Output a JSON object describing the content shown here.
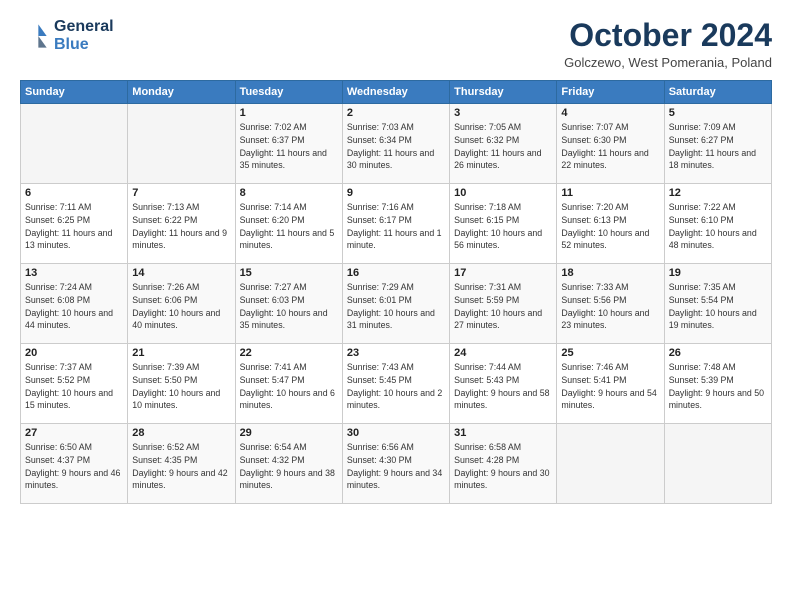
{
  "logo": {
    "line1": "General",
    "line2": "Blue"
  },
  "header": {
    "title": "October 2024",
    "subtitle": "Golczewo, West Pomerania, Poland"
  },
  "weekdays": [
    "Sunday",
    "Monday",
    "Tuesday",
    "Wednesday",
    "Thursday",
    "Friday",
    "Saturday"
  ],
  "weeks": [
    [
      {
        "day": null
      },
      {
        "day": null
      },
      {
        "day": 1,
        "sunrise": "Sunrise: 7:02 AM",
        "sunset": "Sunset: 6:37 PM",
        "daylight": "Daylight: 11 hours and 35 minutes."
      },
      {
        "day": 2,
        "sunrise": "Sunrise: 7:03 AM",
        "sunset": "Sunset: 6:34 PM",
        "daylight": "Daylight: 11 hours and 30 minutes."
      },
      {
        "day": 3,
        "sunrise": "Sunrise: 7:05 AM",
        "sunset": "Sunset: 6:32 PM",
        "daylight": "Daylight: 11 hours and 26 minutes."
      },
      {
        "day": 4,
        "sunrise": "Sunrise: 7:07 AM",
        "sunset": "Sunset: 6:30 PM",
        "daylight": "Daylight: 11 hours and 22 minutes."
      },
      {
        "day": 5,
        "sunrise": "Sunrise: 7:09 AM",
        "sunset": "Sunset: 6:27 PM",
        "daylight": "Daylight: 11 hours and 18 minutes."
      }
    ],
    [
      {
        "day": 6,
        "sunrise": "Sunrise: 7:11 AM",
        "sunset": "Sunset: 6:25 PM",
        "daylight": "Daylight: 11 hours and 13 minutes."
      },
      {
        "day": 7,
        "sunrise": "Sunrise: 7:13 AM",
        "sunset": "Sunset: 6:22 PM",
        "daylight": "Daylight: 11 hours and 9 minutes."
      },
      {
        "day": 8,
        "sunrise": "Sunrise: 7:14 AM",
        "sunset": "Sunset: 6:20 PM",
        "daylight": "Daylight: 11 hours and 5 minutes."
      },
      {
        "day": 9,
        "sunrise": "Sunrise: 7:16 AM",
        "sunset": "Sunset: 6:17 PM",
        "daylight": "Daylight: 11 hours and 1 minute."
      },
      {
        "day": 10,
        "sunrise": "Sunrise: 7:18 AM",
        "sunset": "Sunset: 6:15 PM",
        "daylight": "Daylight: 10 hours and 56 minutes."
      },
      {
        "day": 11,
        "sunrise": "Sunrise: 7:20 AM",
        "sunset": "Sunset: 6:13 PM",
        "daylight": "Daylight: 10 hours and 52 minutes."
      },
      {
        "day": 12,
        "sunrise": "Sunrise: 7:22 AM",
        "sunset": "Sunset: 6:10 PM",
        "daylight": "Daylight: 10 hours and 48 minutes."
      }
    ],
    [
      {
        "day": 13,
        "sunrise": "Sunrise: 7:24 AM",
        "sunset": "Sunset: 6:08 PM",
        "daylight": "Daylight: 10 hours and 44 minutes."
      },
      {
        "day": 14,
        "sunrise": "Sunrise: 7:26 AM",
        "sunset": "Sunset: 6:06 PM",
        "daylight": "Daylight: 10 hours and 40 minutes."
      },
      {
        "day": 15,
        "sunrise": "Sunrise: 7:27 AM",
        "sunset": "Sunset: 6:03 PM",
        "daylight": "Daylight: 10 hours and 35 minutes."
      },
      {
        "day": 16,
        "sunrise": "Sunrise: 7:29 AM",
        "sunset": "Sunset: 6:01 PM",
        "daylight": "Daylight: 10 hours and 31 minutes."
      },
      {
        "day": 17,
        "sunrise": "Sunrise: 7:31 AM",
        "sunset": "Sunset: 5:59 PM",
        "daylight": "Daylight: 10 hours and 27 minutes."
      },
      {
        "day": 18,
        "sunrise": "Sunrise: 7:33 AM",
        "sunset": "Sunset: 5:56 PM",
        "daylight": "Daylight: 10 hours and 23 minutes."
      },
      {
        "day": 19,
        "sunrise": "Sunrise: 7:35 AM",
        "sunset": "Sunset: 5:54 PM",
        "daylight": "Daylight: 10 hours and 19 minutes."
      }
    ],
    [
      {
        "day": 20,
        "sunrise": "Sunrise: 7:37 AM",
        "sunset": "Sunset: 5:52 PM",
        "daylight": "Daylight: 10 hours and 15 minutes."
      },
      {
        "day": 21,
        "sunrise": "Sunrise: 7:39 AM",
        "sunset": "Sunset: 5:50 PM",
        "daylight": "Daylight: 10 hours and 10 minutes."
      },
      {
        "day": 22,
        "sunrise": "Sunrise: 7:41 AM",
        "sunset": "Sunset: 5:47 PM",
        "daylight": "Daylight: 10 hours and 6 minutes."
      },
      {
        "day": 23,
        "sunrise": "Sunrise: 7:43 AM",
        "sunset": "Sunset: 5:45 PM",
        "daylight": "Daylight: 10 hours and 2 minutes."
      },
      {
        "day": 24,
        "sunrise": "Sunrise: 7:44 AM",
        "sunset": "Sunset: 5:43 PM",
        "daylight": "Daylight: 9 hours and 58 minutes."
      },
      {
        "day": 25,
        "sunrise": "Sunrise: 7:46 AM",
        "sunset": "Sunset: 5:41 PM",
        "daylight": "Daylight: 9 hours and 54 minutes."
      },
      {
        "day": 26,
        "sunrise": "Sunrise: 7:48 AM",
        "sunset": "Sunset: 5:39 PM",
        "daylight": "Daylight: 9 hours and 50 minutes."
      }
    ],
    [
      {
        "day": 27,
        "sunrise": "Sunrise: 6:50 AM",
        "sunset": "Sunset: 4:37 PM",
        "daylight": "Daylight: 9 hours and 46 minutes."
      },
      {
        "day": 28,
        "sunrise": "Sunrise: 6:52 AM",
        "sunset": "Sunset: 4:35 PM",
        "daylight": "Daylight: 9 hours and 42 minutes."
      },
      {
        "day": 29,
        "sunrise": "Sunrise: 6:54 AM",
        "sunset": "Sunset: 4:32 PM",
        "daylight": "Daylight: 9 hours and 38 minutes."
      },
      {
        "day": 30,
        "sunrise": "Sunrise: 6:56 AM",
        "sunset": "Sunset: 4:30 PM",
        "daylight": "Daylight: 9 hours and 34 minutes."
      },
      {
        "day": 31,
        "sunrise": "Sunrise: 6:58 AM",
        "sunset": "Sunset: 4:28 PM",
        "daylight": "Daylight: 9 hours and 30 minutes."
      },
      {
        "day": null
      },
      {
        "day": null
      }
    ]
  ]
}
